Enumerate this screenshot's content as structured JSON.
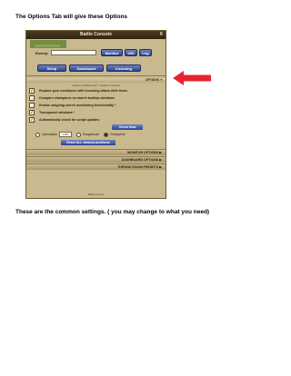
{
  "heading": "The Options Tab will give these Options",
  "footer_note": "These are the common settings. ( you may change to what you need)",
  "console": {
    "title": "Battle Console",
    "close_glyph": "X",
    "enemy_label": "Enemy:",
    "buttons_row1": [
      "Monitor",
      "UID",
      "Log"
    ],
    "buttons_row2": [
      "Sleep",
      "Dashboard",
      "Incoming"
    ],
    "options_label": "OPTIONS ▼",
    "options_note": "Options marked with * require a refresh",
    "options": [
      {
        "label": "Replace gem containers with incoming attack alert times",
        "checked": true
      },
      {
        "label": "Compare champions on march tooltips windows",
        "checked": false
      },
      {
        "label": "Enable outgoing march monitoring functionality *",
        "checked": false
      },
      {
        "label": "Transparent windows *",
        "checked": true
      },
      {
        "label": "Automatically check for script updates",
        "checked": true
      }
    ],
    "check_now": "Check Now",
    "radios": {
      "userscripts": "Userscripts",
      "userscripts_id": "0100",
      "googlecode": "Googlecode",
      "greasyfork": "Greasyfork"
    },
    "reset_label": "Reset ALL window positions",
    "sections": [
      "MONITOR OPTIONS ▶",
      "DASHBOARD OPTIONS ▶",
      "THRONE ROOM PRESETS ▶"
    ],
    "footer": "Battle Console"
  },
  "colors": {
    "arrow": "#e8232f",
    "button": "#2f4590",
    "panel": "#c8b98e"
  }
}
